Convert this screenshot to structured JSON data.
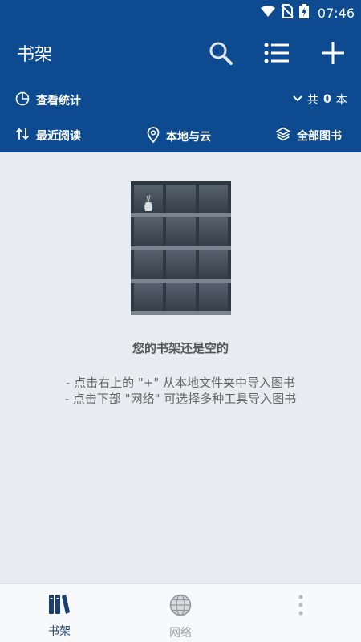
{
  "status_bar": {
    "time": "07:46",
    "icons": [
      "wifi-icon",
      "no-sim-icon",
      "battery-charging-icon"
    ]
  },
  "app_bar": {
    "title": "书架",
    "actions": [
      "search-icon",
      "list-icon",
      "add-icon"
    ]
  },
  "info_row": {
    "stats_label": "查看统计",
    "count_prefix": "共",
    "count_value": "0",
    "count_suffix": "本"
  },
  "filter_row": {
    "sort_label": "最近阅读",
    "source_label": "本地与云",
    "category_label": "全部图书"
  },
  "empty_state": {
    "title": "您的书架还是空的",
    "hint_1": "- 点击右上的 \"+\" 从本地文件夹中导入图书",
    "hint_2": "- 点击下部 \"网络\" 可选择多种工具导入图书"
  },
  "bottom_nav": {
    "items": [
      {
        "label": "书架",
        "icon": "books-icon",
        "active": true
      },
      {
        "label": "网络",
        "icon": "globe-icon",
        "active": false
      },
      {
        "label": "",
        "icon": "more-vertical-icon",
        "active": false
      }
    ]
  },
  "colors": {
    "primary": "#0d4a8f",
    "background": "#e8ebef",
    "active_nav": "#1b3f73",
    "inactive_nav": "#9aa0a6"
  }
}
